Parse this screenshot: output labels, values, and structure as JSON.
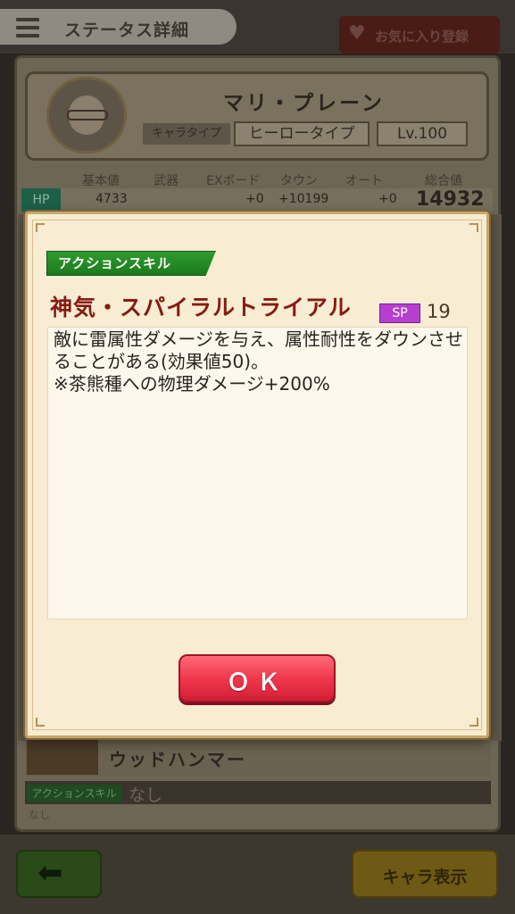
{
  "header": {
    "title": "ステータス詳細",
    "favorite_label": "お気に入り登録"
  },
  "character": {
    "name": "マリ・プレーン",
    "type_label": "キャラタイプ",
    "type_value": "ヒーロータイプ",
    "level": "Lv.100"
  },
  "stats": {
    "headers": [
      "基本値",
      "武器",
      "EXボード",
      "タウン",
      "オート",
      "総合値"
    ],
    "hp_label": "HP",
    "hp_base": "4733",
    "hp_ex": "+0",
    "hp_town": "+10199",
    "hp_auto": "+0",
    "hp_total": "14932"
  },
  "weapon": {
    "name": "ウッドハンマー",
    "skill_tag": "アクションスキル",
    "skill_value": "なし",
    "skill_sub": "なし"
  },
  "dialog": {
    "tag": "アクションスキル",
    "skill_name": "神気・スパイラルトライアル",
    "sp_label": "SP",
    "sp_value": "19",
    "description": "敵に雷属性ダメージを与え、属性耐性をダウンさせることがある(効果値50)。\n※茶熊種への物理ダメージ+200%",
    "ok_label": "ＯＫ"
  },
  "footer": {
    "back_icon": "left-arrow-icon",
    "chara_display_label": "キャラ表示"
  },
  "colors": {
    "accent_green": "#1b7a1c",
    "ok_red": "#f0384c",
    "sp_purple": "#b63fd0",
    "skill_name_red": "#851c13"
  }
}
